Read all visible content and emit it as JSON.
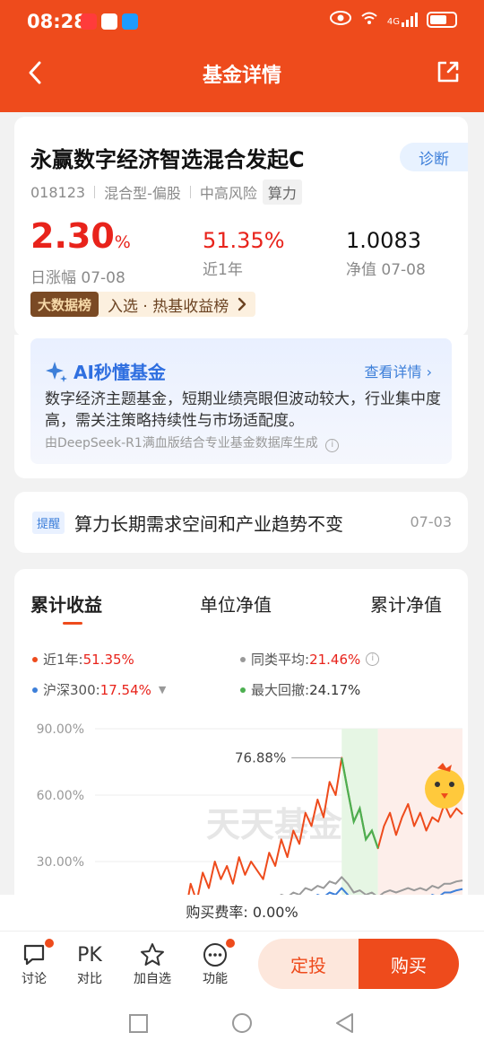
{
  "status": {
    "time": "08:28",
    "network": "4G"
  },
  "header": {
    "title": "基金详情"
  },
  "fund": {
    "name": "永赢数字经济智选混合发起C",
    "diagnose_label": "诊断",
    "code": "018123",
    "type": "混合型-偏股",
    "risk": "中高风险",
    "tag": "算力",
    "daily_change": "2.30",
    "daily_change_unit": "%",
    "daily_change_label": "日涨幅 07-08",
    "year_return": "51.35%",
    "year_return_label": "近1年",
    "nav": "1.0083",
    "nav_label": "净值 07-08",
    "rank_badge": "大数据榜",
    "rank_text": "入选 · 热基收益榜"
  },
  "ai": {
    "title": "AI秒懂基金",
    "link": "查看详情",
    "body": "数字经济主题基金，短期业绩亮眼但波动较大，行业集中度高，需关注策略持续性与市场适配度。",
    "footer": "由DeepSeek-R1满血版结合专业基金数据库生成"
  },
  "reminder": {
    "tag": "提醒",
    "text": "算力长期需求空间和产业趋势不变",
    "date": "07-03"
  },
  "chart_tabs": [
    "累计收益",
    "单位净值",
    "累计净值"
  ],
  "legend": [
    {
      "label": "近1年:",
      "value": "51.35%",
      "color": "#ee4b1c"
    },
    {
      "label": "同类平均:",
      "value": "21.46%",
      "color": "#999999"
    },
    {
      "label": "沪深300:",
      "value": "17.54%",
      "color": "#3d7fd9"
    },
    {
      "label": "最大回撤:",
      "value": "24.17%",
      "color": "#4caf50"
    }
  ],
  "chart_data": {
    "type": "line",
    "yticks": [
      "90.00%",
      "60.00%",
      "30.00%"
    ],
    "ylim": [
      0,
      90
    ],
    "peak_label": "76.88%",
    "watermark": "天天基金",
    "series": [
      {
        "name": "近1年",
        "color": "#ee4b1c",
        "values": [
          5,
          20,
          12,
          25,
          18,
          30,
          22,
          28,
          20,
          32,
          24,
          30,
          26,
          22,
          34,
          28,
          40,
          32,
          44,
          38,
          52,
          46,
          58,
          50,
          66,
          60,
          76.88,
          62,
          48,
          54,
          40,
          44,
          36,
          46,
          52,
          42,
          50,
          56,
          46,
          52,
          44,
          50,
          48,
          56,
          50,
          54,
          51.35
        ]
      },
      {
        "name": "同类平均",
        "color": "#999999",
        "values": [
          4,
          10,
          8,
          11,
          9,
          12,
          10,
          12,
          11,
          13,
          12,
          13,
          12,
          11,
          14,
          13,
          15,
          14,
          16,
          15,
          18,
          17,
          19,
          18,
          21,
          20,
          23,
          20,
          16,
          17,
          15,
          16,
          14,
          16,
          17,
          16,
          17,
          18,
          17,
          18,
          17,
          19,
          18,
          20,
          20,
          21,
          21.46
        ]
      },
      {
        "name": "沪深300",
        "color": "#3d7fd9",
        "values": [
          3,
          8,
          6,
          9,
          7,
          10,
          8,
          9,
          8,
          10,
          9,
          10,
          9,
          8,
          11,
          10,
          12,
          11,
          13,
          12,
          14,
          13,
          15,
          14,
          16,
          15,
          18,
          15,
          12,
          13,
          11,
          12,
          10,
          12,
          13,
          12,
          13,
          14,
          13,
          14,
          13,
          15,
          14,
          16,
          16,
          17,
          17.54
        ]
      }
    ]
  },
  "fee": {
    "text": "购买费率: 0.00%"
  },
  "bottom_nav": [
    {
      "label": "讨论",
      "icon": "chat-icon"
    },
    {
      "label": "对比",
      "icon": "pk-icon",
      "glyph": "PK"
    },
    {
      "label": "加自选",
      "icon": "star-icon"
    },
    {
      "label": "功能",
      "icon": "more-icon"
    }
  ],
  "actions": {
    "dingtou": "定投",
    "buy": "购买"
  }
}
